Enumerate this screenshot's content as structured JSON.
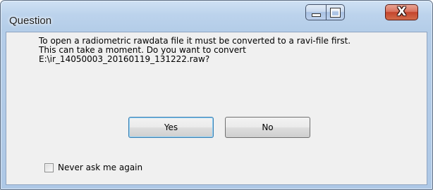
{
  "window": {
    "title": "Question",
    "controls": {
      "minimize_icon": "minimize-icon",
      "maximize_icon": "maximize-icon",
      "close_icon": "close-icon",
      "close_glyph": "X"
    }
  },
  "dialog": {
    "message_lines": [
      "To open a radiometric rawdata file it must be converted to a ravi-file first.",
      "This can take a moment. Do you want to convert",
      "E:\\ir_14050003_20160119_131222.raw?"
    ],
    "buttons": {
      "yes": "Yes",
      "no": "No"
    },
    "checkbox": {
      "label": "Never ask me again",
      "checked": false
    }
  },
  "colors": {
    "frame_accent": "#b4cde8",
    "close_button": "#c4452d",
    "default_button_border": "#3c7fb1",
    "client_background": "#f0f0f0"
  }
}
